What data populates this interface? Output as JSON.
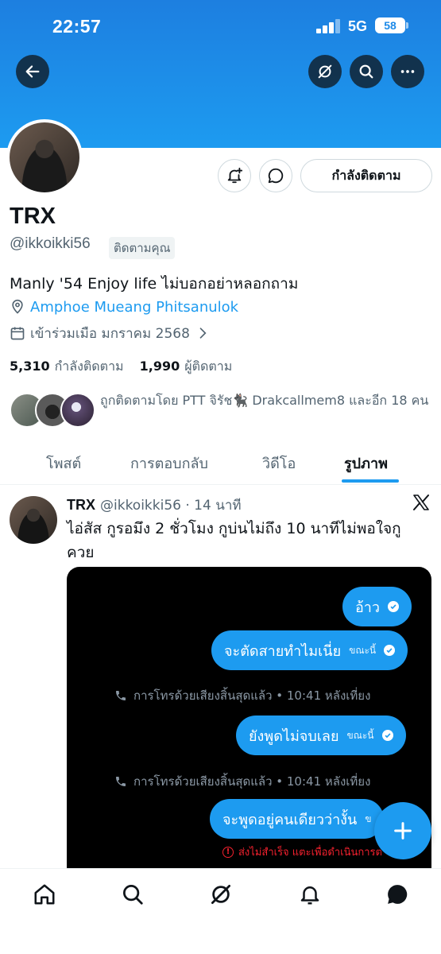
{
  "status_bar": {
    "time": "22:57",
    "network": "5G",
    "battery": "58"
  },
  "header": {
    "back_icon": "arrow-left-icon",
    "grok_icon": "grok-icon",
    "search_icon": "search-icon",
    "more_icon": "ellipsis-icon"
  },
  "profile": {
    "name": "TRX",
    "handle": "@ikkoikki56",
    "follows_you": "ติดตามคุณ",
    "follow_button": "กำลังติดตาม",
    "bio": "Manly '54 Enjoy life ไม่บอกอย่าหลอกถาม",
    "location": "Amphoe Mueang Phitsanulok",
    "joined": "เข้าร่วมเมือ มกราคม 2568",
    "following_count": "5,310",
    "following_label": "กำลังติดตาม",
    "followers_count": "1,990",
    "followers_label": "ผู้ติดตาม",
    "mutuals_text": "ถูกติดตามโดย PTT จิรัช🐈‍⬛ Drakcallmem8 และอีก 18 คน"
  },
  "tabs": [
    {
      "label": "โพสต์",
      "active": false
    },
    {
      "label": "การตอบกลับ",
      "active": false
    },
    {
      "label": "วิดีโอ",
      "active": false
    },
    {
      "label": "รูปภาพ",
      "active": true
    }
  ],
  "tweet": {
    "name": "TRX",
    "meta": "@ikkoikki56 · 14 นาที",
    "text": "ไอ่สัส กูรอมึง 2 ชั่วโมง กูบ่นไม่ถึง 10 นาทีไม่พอใจกู ควย",
    "media": {
      "bubble_1": "อ้าว",
      "bubble_2": "จะตัดสายทำไมเนี่ย",
      "bubble_2_time": "ขณะนี้",
      "call_ended_1": "การโทรด้วยเสียงสิ้นสุดแล้ว • 10:41 หลังเที่ยง",
      "bubble_3": "ยังพูดไม่จบเลย",
      "bubble_3_time": "ขณะนี้",
      "call_ended_2": "การโทรด้วยเสียงสิ้นสุดแล้ว • 10:41 หลังเที่ยง",
      "bubble_4": "จะพูดอยู่คนเดียวว่างั้น",
      "bubble_4_time": "ข",
      "failed_text": "ส่งไม่สำเร็จ แตะเพื่อดำเนินการต่"
    }
  },
  "colors": {
    "accent": "#1d9bf0",
    "text": "#0f1419",
    "muted": "#536471"
  },
  "bottom_nav": [
    "home-icon",
    "search-icon",
    "grok-icon",
    "bell-icon",
    "messages-icon"
  ]
}
